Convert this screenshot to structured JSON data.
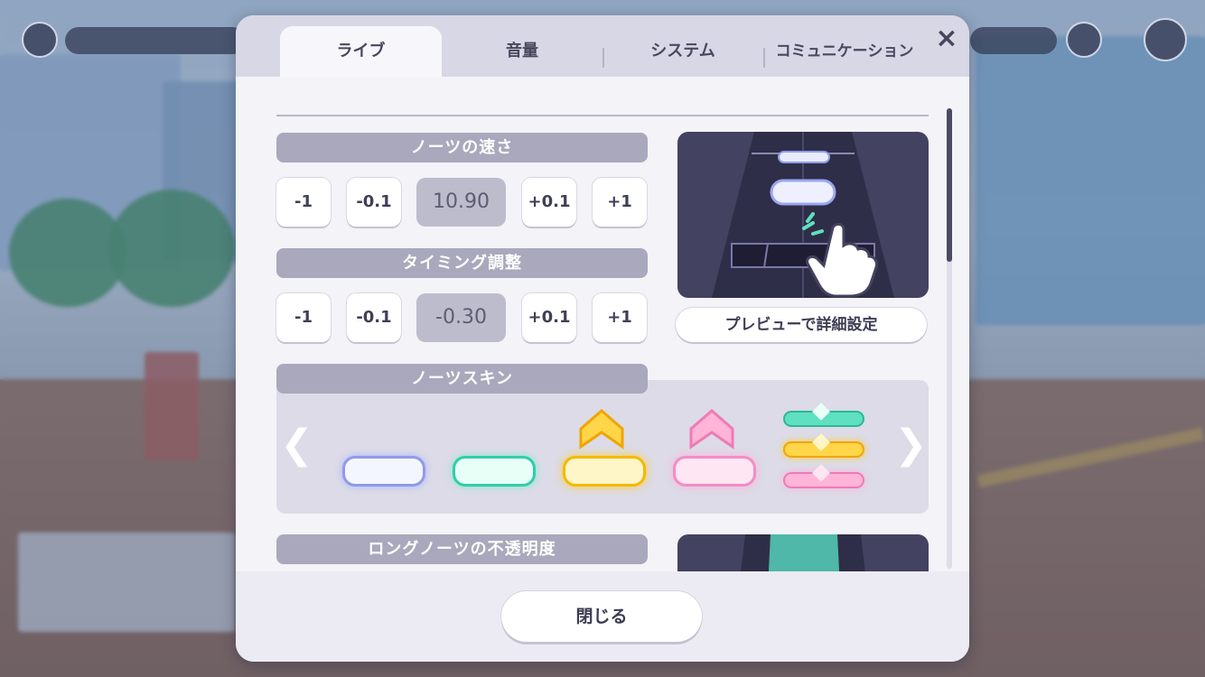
{
  "tabs": [
    {
      "label": "ライブ",
      "active": true
    },
    {
      "label": "音量",
      "active": false
    },
    {
      "label": "システム",
      "active": false
    },
    {
      "label": "コミュニケーション",
      "active": false
    }
  ],
  "close_icon": "×",
  "note_speed": {
    "label": "ノーツの速さ",
    "buttons": [
      "-1",
      "-0.1",
      "+0.1",
      "+1"
    ],
    "value": "10.90"
  },
  "timing": {
    "label": "タイミング調整",
    "buttons": [
      "-1",
      "-0.1",
      "+0.1",
      "+1"
    ],
    "value": "-0.30"
  },
  "preview_button": "プレビューで詳細設定",
  "note_skin": {
    "label": "ノーツスキン",
    "prev_icon": "chevron-left-icon",
    "next_icon": "chevron-right-icon",
    "colors": {
      "normal": "#c6d2ff",
      "green": "#5fe0c0",
      "yellow": "#ffd54a",
      "pink": "#ff9fd0"
    }
  },
  "long_opacity": {
    "label": "ロングノーツの不透明度"
  },
  "close_button": "閉じる"
}
